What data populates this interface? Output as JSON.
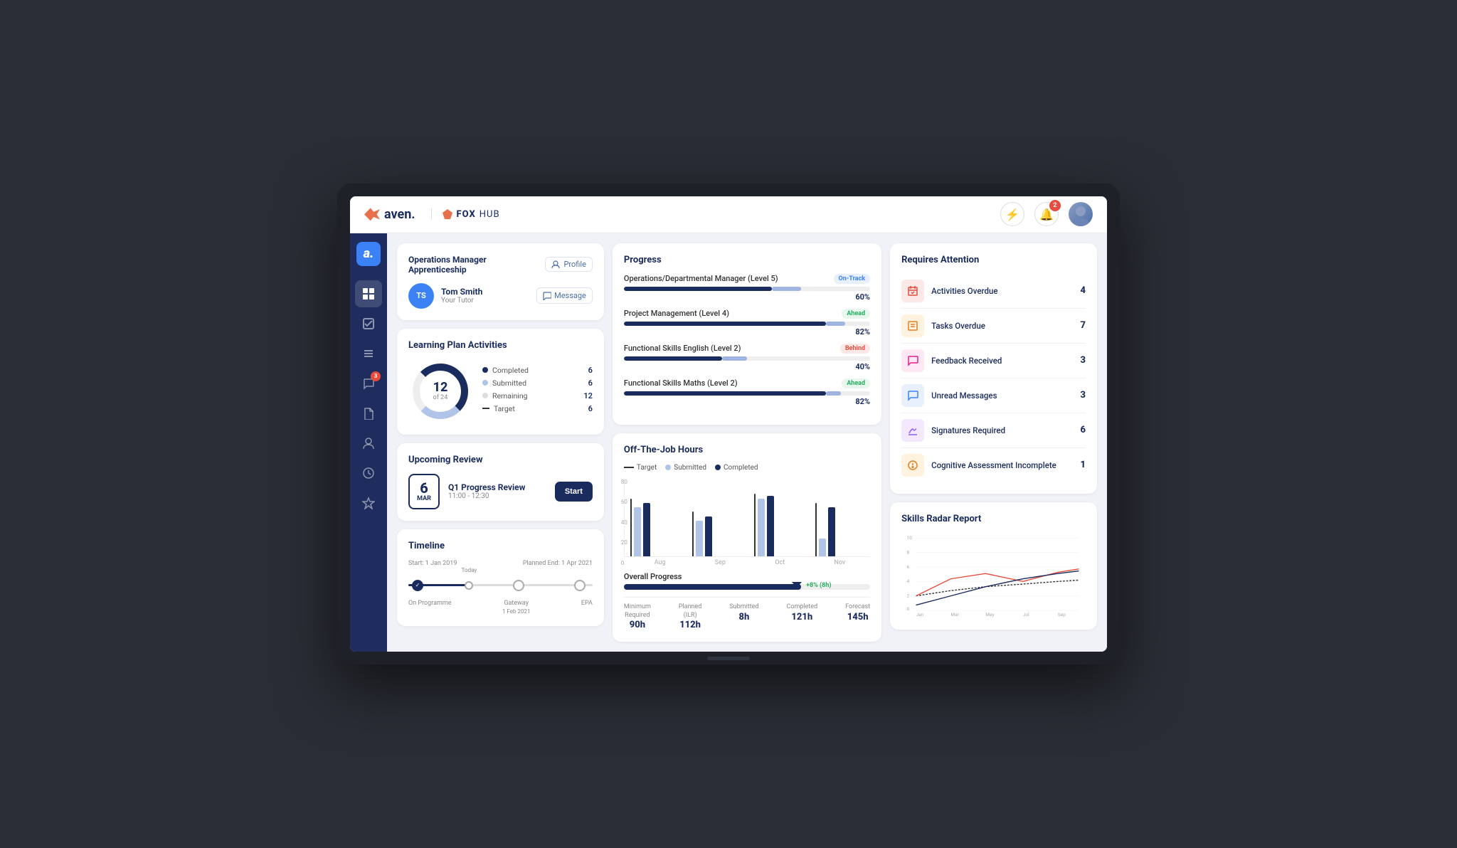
{
  "topBar": {
    "logoAven": "aven.",
    "logoFoxHub": "FOXHUB",
    "notificationCount": "2",
    "flashLabel": "⚡"
  },
  "sidebar": {
    "logo": "a.",
    "items": [
      {
        "name": "dashboard",
        "icon": "▦",
        "active": true,
        "badge": null
      },
      {
        "name": "tasks",
        "icon": "✓",
        "active": false,
        "badge": null
      },
      {
        "name": "activities",
        "icon": "☰",
        "active": false,
        "badge": null
      },
      {
        "name": "messages",
        "icon": "💬",
        "active": false,
        "badge": "3"
      },
      {
        "name": "documents",
        "icon": "📄",
        "active": false,
        "badge": null
      },
      {
        "name": "profile",
        "icon": "👤",
        "active": false,
        "badge": null
      },
      {
        "name": "reports",
        "icon": "🕐",
        "active": false,
        "badge": null
      },
      {
        "name": "awards",
        "icon": "🏅",
        "active": false,
        "badge": null
      }
    ]
  },
  "profileCard": {
    "title": "Operations Manager Apprenticeship",
    "profileBtnLabel": "Profile",
    "tutorInitials": "TS",
    "tutorName": "Tom Smith",
    "tutorRole": "Your Tutor",
    "messageBtnLabel": "Message"
  },
  "learningPlan": {
    "title": "Learning Plan Activities",
    "total": "12",
    "totalSub": "of 24",
    "completed": {
      "label": "Completed",
      "value": "6"
    },
    "submitted": {
      "label": "Submitted",
      "value": "6"
    },
    "remaining": {
      "label": "Remaining",
      "value": "12"
    },
    "target": {
      "label": "Target",
      "value": "6"
    }
  },
  "upcomingReview": {
    "title": "Upcoming Review",
    "day": "6",
    "month": "MAR",
    "name": "Q1 Progress Review",
    "time": "11:00 - 12:30",
    "startBtn": "Start"
  },
  "timeline": {
    "title": "Timeline",
    "startLabel": "Start: 1 Jan 2019",
    "endLabel": "Planned End: 1 Apr 2021",
    "todayLabel": "Today",
    "milestones": [
      {
        "label": "On Programme",
        "position": 0
      },
      {
        "label": "Gateway",
        "sublabel": "1 Feb 2021",
        "position": 50
      },
      {
        "label": "EPA",
        "position": 100
      }
    ]
  },
  "progress": {
    "title": "Progress",
    "items": [
      {
        "name": "Operations/Departmental Manager (Level 5)",
        "badge": "On-Track",
        "badgeClass": "ontrack",
        "fillPct": 60,
        "lightPct": 72,
        "pct": "60%"
      },
      {
        "name": "Project Management (Level 4)",
        "badge": "Ahead",
        "badgeClass": "ahead",
        "fillPct": 82,
        "lightPct": 90,
        "pct": "82%"
      },
      {
        "name": "Functional Skills English (Level 2)",
        "badge": "Behind",
        "badgeClass": "behind",
        "fillPct": 40,
        "lightPct": 50,
        "pct": "40%"
      },
      {
        "name": "Functional Skills Maths (Level 2)",
        "badge": "Ahead",
        "badgeClass": "ahead",
        "fillPct": 82,
        "lightPct": 88,
        "pct": "82%"
      }
    ]
  },
  "offTheJob": {
    "title": "Off-The-Job Hours",
    "legendTarget": "Target",
    "legendSubmitted": "Submitted",
    "legendCompleted": "Completed",
    "bars": [
      {
        "month": "Aug",
        "target": 65,
        "submitted": 55,
        "completed": 60
      },
      {
        "month": "Sep",
        "target": 50,
        "submitted": 40,
        "completed": 45
      },
      {
        "month": "Oct",
        "target": 70,
        "submitted": 65,
        "completed": 68
      },
      {
        "month": "Nov",
        "target": 60,
        "submitted": 20,
        "completed": 55
      }
    ],
    "overallLabel": "Overall Progress",
    "overallPct": "+8% (8h)",
    "overallFill": 72,
    "stats": [
      {
        "label": "Minimum\nRequired",
        "value": "90h"
      },
      {
        "label": "Planned\n(ILR)",
        "value": "112h"
      },
      {
        "label": "Submitted",
        "value": "8h"
      },
      {
        "label": "Completed",
        "value": "121h"
      },
      {
        "label": "Forecast",
        "value": "145h"
      }
    ]
  },
  "requiresAttention": {
    "title": "Requires Attention",
    "items": [
      {
        "icon": "📋",
        "iconClass": "red",
        "label": "Activities Overdue",
        "count": "4"
      },
      {
        "icon": "📝",
        "iconClass": "orange",
        "label": "Tasks Overdue",
        "count": "7"
      },
      {
        "icon": "💬",
        "iconClass": "pink",
        "label": "Feedback Received",
        "count": "3"
      },
      {
        "icon": "💬",
        "iconClass": "blue",
        "label": "Unread Messages",
        "count": "3"
      },
      {
        "icon": "✍",
        "iconClass": "purple",
        "label": "Signatures Required",
        "count": "6"
      },
      {
        "icon": "🎯",
        "iconClass": "orange",
        "label": "Cognitive Assessment Incomplete",
        "count": "1"
      }
    ]
  },
  "skillsRadar": {
    "title": "Skills Radar Report",
    "xLabels": [
      "Jan",
      "Mar",
      "May",
      "Jul",
      "Sep"
    ],
    "yMax": "10",
    "yValues": [
      "10",
      "8",
      "6",
      "4",
      "2",
      "0"
    ]
  }
}
